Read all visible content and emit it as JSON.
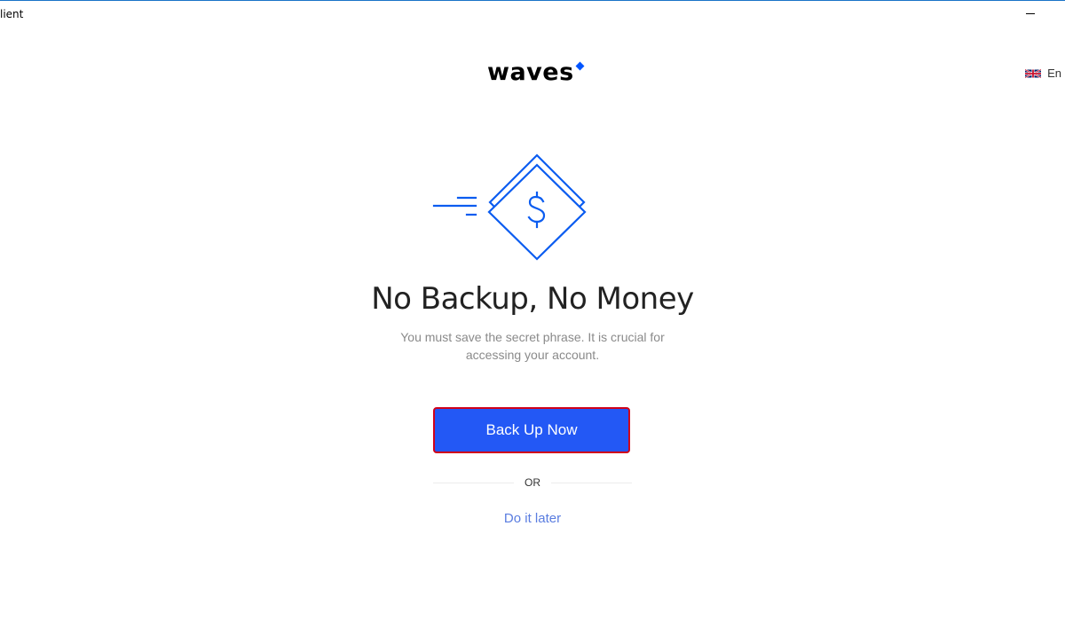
{
  "window": {
    "title": "lient"
  },
  "header": {
    "logo_text": "waves",
    "language": "En",
    "language_flag": "uk-flag-icon"
  },
  "main": {
    "illustration": "money-diamond-icon",
    "heading": "No Backup, No Money",
    "subtitle_line1": "You must save the secret phrase. It is crucial for",
    "subtitle_line2": "accessing your account.",
    "primary_button": "Back Up Now",
    "divider_text": "OR",
    "secondary_link": "Do it later"
  },
  "colors": {
    "accent": "#2358f5",
    "link": "#5a7de0",
    "highlight_border": "#d0021b",
    "brand_diamond": "#0055ff"
  }
}
